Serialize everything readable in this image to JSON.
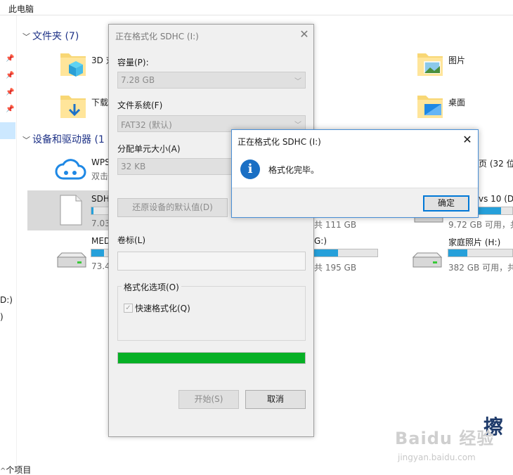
{
  "breadcrumb": "此电脑",
  "nav": {
    "drive_d": "D:)",
    "drive_e": ")",
    "items_count": "个项目"
  },
  "folders_section": {
    "header": "文件夹 (7)",
    "items": [
      {
        "name": "3D 对",
        "icon": "folder-3d-objects-icon"
      },
      {
        "name": "下载",
        "icon": "folder-downloads-icon"
      },
      {
        "name": "图片",
        "icon": "folder-pictures-icon"
      },
      {
        "name": "桌面",
        "icon": "folder-desktop-icon"
      }
    ]
  },
  "devices_section": {
    "header": "设备和驱动器 (1",
    "items": [
      {
        "name": "WPS",
        "sub": "双击"
      },
      {
        "name": "SDH",
        "sub": "7.03"
      },
      {
        "name": "MED",
        "sub": "73.4"
      }
    ],
    "right_items": [
      {
        "name": "页 (32 位)",
        "sub": ""
      },
      {
        "name": "vs 10 (D:",
        "sub": "9.72 GB 可用，共"
      },
      {
        "name": "家庭照片 (H:)",
        "sub": "382 GB 可用，共"
      }
    ],
    "mid_items": [
      {
        "sub": "共 111 GB"
      },
      {
        "name": "G:)",
        "sub": "共 195 GB"
      }
    ]
  },
  "format_dialog": {
    "title": "正在格式化 SDHC (I:)",
    "capacity_label": "容量(P):",
    "capacity_value": "7.28 GB",
    "filesystem_label": "文件系统(F)",
    "filesystem_value": "FAT32 (默认)",
    "alloc_label": "分配单元大小(A)",
    "alloc_value": "32 KB",
    "restore_button": "还原设备的默认值(D)",
    "volume_label": "卷标(L)",
    "volume_value": "",
    "options_label": "格式化选项(O)",
    "quick_format": "快速格式化(Q)",
    "progress": 1.0,
    "progress_color": "#06b025",
    "start_button": "开始(S)",
    "cancel_button": "取消"
  },
  "message_box": {
    "title": "正在格式化 SDHC (I:)",
    "text": "格式化完毕。",
    "ok_button": "确定"
  },
  "watermark": {
    "logo": "Baidu 经验",
    "url": "jingyan.baidu.com",
    "corner": "擦"
  }
}
